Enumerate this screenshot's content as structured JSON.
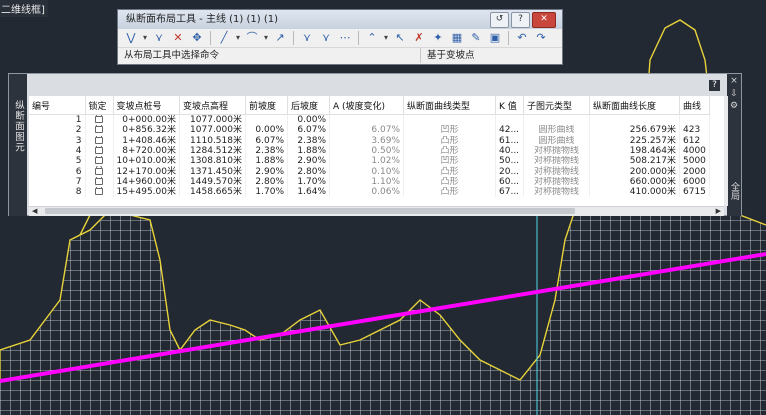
{
  "corner_label": "二维线框]",
  "toolbar": {
    "title": "纵断面布局工具 - 主线 (1) (1) (1)",
    "window_buttons": [
      "↺",
      "?",
      "✕"
    ],
    "icons": [
      "pvi-dropdown-icon",
      "insert-pvi-icon",
      "delete-pvi-icon",
      "move-pvi-icon",
      "draw-tangent-icon",
      "free-curve-icon",
      "edit-curve-icon",
      "raise-lower-icon",
      "insert-curve-icon",
      "fixed-curve-icon",
      "select-pvi-icon",
      "delete-entity-icon",
      "copy-profile-icon",
      "grid-view-icon",
      "properties-icon",
      "undo-icon",
      "redo-icon"
    ],
    "status_left": "从布局工具中选择命令",
    "status_right": "基于变坡点"
  },
  "panel": {
    "side_label": "纵断面图元",
    "help_label": "?",
    "right_labels": [
      "×",
      "⇩",
      "⚙",
      "全局"
    ]
  },
  "table": {
    "headers": [
      "编号",
      "锁定",
      "变坡点桩号",
      "变坡点高程",
      "前坡度",
      "后坡度",
      "A (坡度变化)",
      "纵断面曲线类型",
      "K 值",
      "子图元类型",
      "纵断面曲线长度",
      "曲线"
    ],
    "rows": [
      [
        "1",
        "🔒",
        "0+000.00米",
        "1077.000米",
        "",
        "0.00%",
        "",
        "",
        "",
        "",
        "",
        ""
      ],
      [
        "2",
        "🔒",
        "0+856.32米",
        "1077.000米",
        "0.00%",
        "6.07%",
        "6.07%",
        "凹形",
        "42...",
        "圆形曲线",
        "256.679米",
        "423"
      ],
      [
        "3",
        "🔒",
        "1+408.46米",
        "1110.518米",
        "6.07%",
        "2.38%",
        "3.69%",
        "凸形",
        "61...",
        "圆形曲线",
        "225.257米",
        "612"
      ],
      [
        "4",
        "🔒",
        "8+720.00米",
        "1284.512米",
        "2.38%",
        "1.88%",
        "0.50%",
        "凸形",
        "40...",
        "对称抛物线",
        "198.464米",
        "4000"
      ],
      [
        "5",
        "🔒",
        "10+010.00米",
        "1308.810米",
        "1.88%",
        "2.90%",
        "1.02%",
        "凹形",
        "50...",
        "对称抛物线",
        "508.217米",
        "5000"
      ],
      [
        "6",
        "🔒",
        "12+170.00米",
        "1371.450米",
        "2.90%",
        "2.80%",
        "0.10%",
        "凸形",
        "20...",
        "对称抛物线",
        "200.000米",
        "2000"
      ],
      [
        "7",
        "🔒",
        "14+960.00米",
        "1449.570米",
        "2.80%",
        "1.70%",
        "1.10%",
        "凸形",
        "60...",
        "对称抛物线",
        "660.000米",
        "6000"
      ],
      [
        "8",
        "🔒",
        "15+495.00米",
        "1458.665米",
        "1.70%",
        "1.64%",
        "0.06%",
        "凸形",
        "67...",
        "对称抛物线",
        "410.000米",
        "6715"
      ]
    ]
  },
  "colors": {
    "background": "#222933",
    "grid": "#ffffff",
    "profile_line": "#e8d33a",
    "design_line": "#ff00ff",
    "marker": "#4dd8e8"
  }
}
